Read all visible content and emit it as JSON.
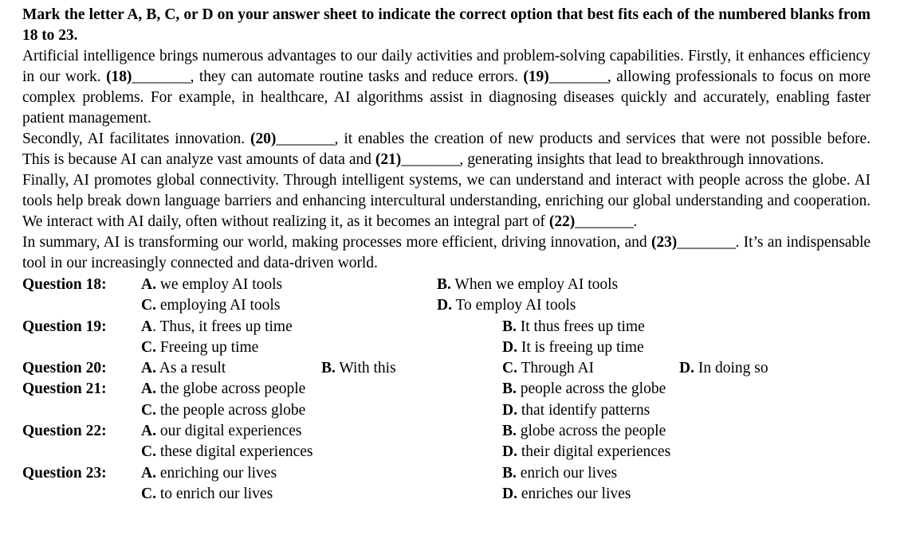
{
  "document": {
    "instruction": "Mark the letter A, B, C, or D on your answer sheet to indicate the correct option that best fits each of the numbered blanks from 18 to 23.",
    "blank_mark": "________",
    "passage": {
      "p1_part1": "Artificial intelligence brings numerous advantages to our daily activities and problem-solving capabilities. Firstly, it enhances efficiency in our work. ",
      "p1_tag18": "(18)",
      "p1_part2": ", they can automate routine tasks and reduce errors. ",
      "p1_tag19": "(19)",
      "p1_part3": ", allowing professionals to focus on more complex problems. For example, in healthcare, AI algorithms assist in diagnosing diseases quickly and accurately, enabling faster patient management.",
      "p2_part1": "Secondly, AI facilitates innovation. ",
      "p2_tag20": "(20)",
      "p2_part2": ", it enables the creation of new products and services that were not possible before. This is because AI can analyze vast amounts of data and ",
      "p2_tag21": "(21)",
      "p2_part3": ", generating insights that lead to breakthrough innovations.",
      "p3_part1": "Finally, AI promotes global connectivity. Through intelligent systems, we can understand and interact with people across the globe. AI tools help break down language barriers and enhancing intercultural understanding, enriching our global understanding and cooperation. We interact with AI daily, often without realizing it, as it becomes an integral part of ",
      "p3_tag22": "(22)",
      "p3_part2": ".",
      "p4_part1": "In summary, AI is transforming our world, making processes more efficient, driving innovation, and ",
      "p4_tag23": "(23)",
      "p4_part2": ". It’s an indispensable tool in our increasingly connected and data-driven world."
    },
    "questions": [
      {
        "label": "Question 18:",
        "layout": "two-column-wide",
        "options": [
          {
            "letter": "A.",
            "text": "we employ AI tools"
          },
          {
            "letter": "B.",
            "text": "When we employ AI tools"
          },
          {
            "letter": "C.",
            "text": "employing AI tools"
          },
          {
            "letter": "D.",
            "text": "To employ AI tools"
          }
        ]
      },
      {
        "label": "Question 19:",
        "layout": "two-column",
        "options": [
          {
            "letter": "A",
            "text": ". Thus, it frees up time"
          },
          {
            "letter": "B.",
            "text": "It thus frees up time"
          },
          {
            "letter": "C.",
            "text": "Freeing up time"
          },
          {
            "letter": "D.",
            "text": "It is freeing up time"
          }
        ]
      },
      {
        "label": "Question 20:",
        "layout": "four-column",
        "options": [
          {
            "letter": "A.",
            "text": "As a result"
          },
          {
            "letter": "B.",
            "text": "With this"
          },
          {
            "letter": "C.",
            "text": "Through AI"
          },
          {
            "letter": "D.",
            "text": "In doing so"
          }
        ]
      },
      {
        "label": "Question 21:",
        "layout": "two-column",
        "options": [
          {
            "letter": "A.",
            "text": "the globe across people"
          },
          {
            "letter": "B.",
            "text": "people across the globe"
          },
          {
            "letter": "C.",
            "text": "the people across globe"
          },
          {
            "letter": "D.",
            "text": "that identify patterns"
          }
        ]
      },
      {
        "label": "Question 22:",
        "layout": "two-column",
        "options": [
          {
            "letter": "A.",
            "text": "our digital experiences"
          },
          {
            "letter": "B.",
            "text": "globe across the people"
          },
          {
            "letter": "C.",
            "text": "these digital experiences"
          },
          {
            "letter": "D.",
            "text": "their digital experiences"
          }
        ]
      },
      {
        "label": "Question 23:",
        "layout": "two-column",
        "options": [
          {
            "letter": "A.",
            "text": "enriching our lives"
          },
          {
            "letter": "B.",
            "text": "enrich our lives"
          },
          {
            "letter": "C.",
            "text": "to enrich our lives"
          },
          {
            "letter": "D.",
            "text": "enriches our lives"
          }
        ]
      }
    ]
  }
}
